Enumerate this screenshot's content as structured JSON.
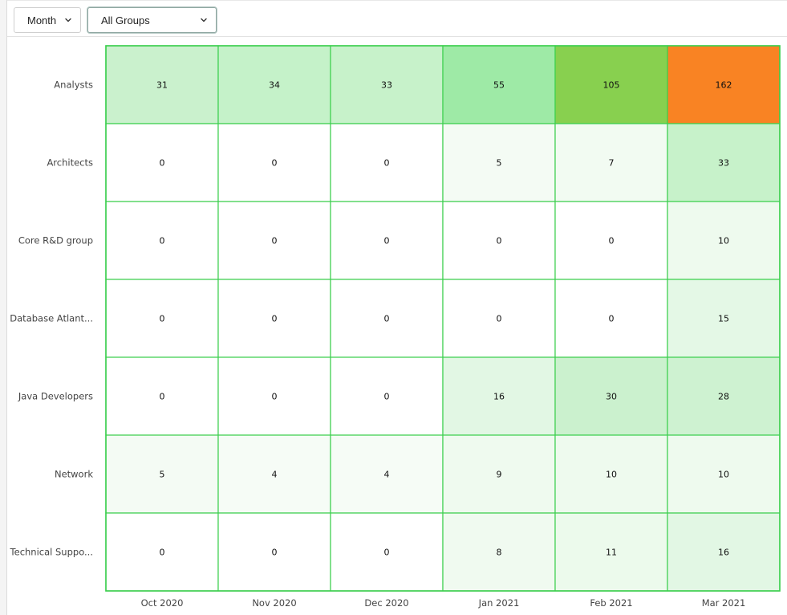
{
  "toolbar": {
    "period_select": {
      "value": "Month"
    },
    "group_select": {
      "value": "All Groups"
    }
  },
  "colors": {
    "cell_border": "#3ccf4e",
    "high_value": "#f98323",
    "mid_high_value": "#88d04f",
    "zero_value": "#ffffff"
  },
  "chart_data": {
    "type": "heatmap",
    "title": "",
    "xlabel": "",
    "ylabel": "",
    "x_categories": [
      "Oct 2020",
      "Nov 2020",
      "Dec 2020",
      "Jan 2021",
      "Feb 2021",
      "Mar 2021"
    ],
    "y_categories": [
      "Analysts",
      "Architects",
      "Core R&D group",
      "Database Atlant...",
      "Java Developers",
      "Network",
      "Technical Suppo..."
    ],
    "values": [
      [
        31,
        34,
        33,
        55,
        105,
        162
      ],
      [
        0,
        0,
        0,
        5,
        7,
        33
      ],
      [
        0,
        0,
        0,
        0,
        0,
        10
      ],
      [
        0,
        0,
        0,
        0,
        0,
        15
      ],
      [
        0,
        0,
        0,
        16,
        30,
        28
      ],
      [
        5,
        4,
        4,
        9,
        10,
        10
      ],
      [
        0,
        0,
        0,
        8,
        11,
        16
      ]
    ],
    "legend": "none",
    "grid": true
  }
}
